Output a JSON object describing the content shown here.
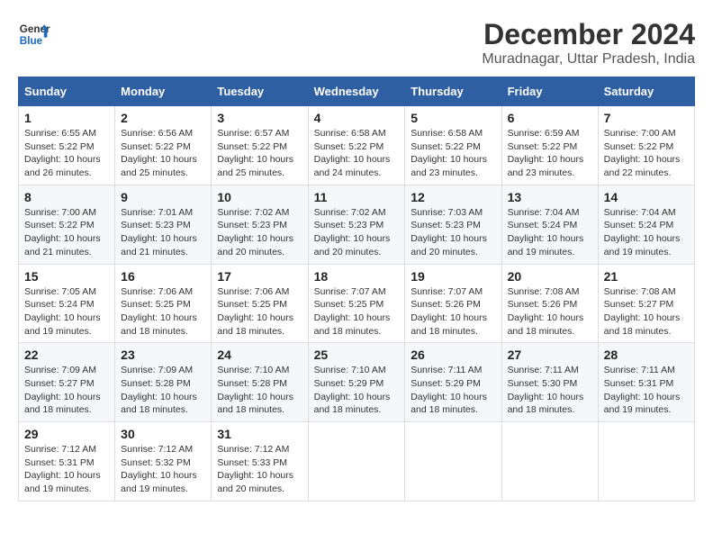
{
  "logo": {
    "line1": "General",
    "line2": "Blue"
  },
  "title": "December 2024",
  "subtitle": "Muradnagar, Uttar Pradesh, India",
  "header_days": [
    "Sunday",
    "Monday",
    "Tuesday",
    "Wednesday",
    "Thursday",
    "Friday",
    "Saturday"
  ],
  "weeks": [
    [
      {
        "day": "1",
        "sunrise": "6:55 AM",
        "sunset": "5:22 PM",
        "daylight": "10 hours and 26 minutes."
      },
      {
        "day": "2",
        "sunrise": "6:56 AM",
        "sunset": "5:22 PM",
        "daylight": "10 hours and 25 minutes."
      },
      {
        "day": "3",
        "sunrise": "6:57 AM",
        "sunset": "5:22 PM",
        "daylight": "10 hours and 25 minutes."
      },
      {
        "day": "4",
        "sunrise": "6:58 AM",
        "sunset": "5:22 PM",
        "daylight": "10 hours and 24 minutes."
      },
      {
        "day": "5",
        "sunrise": "6:58 AM",
        "sunset": "5:22 PM",
        "daylight": "10 hours and 23 minutes."
      },
      {
        "day": "6",
        "sunrise": "6:59 AM",
        "sunset": "5:22 PM",
        "daylight": "10 hours and 23 minutes."
      },
      {
        "day": "7",
        "sunrise": "7:00 AM",
        "sunset": "5:22 PM",
        "daylight": "10 hours and 22 minutes."
      }
    ],
    [
      {
        "day": "8",
        "sunrise": "7:00 AM",
        "sunset": "5:22 PM",
        "daylight": "10 hours and 21 minutes."
      },
      {
        "day": "9",
        "sunrise": "7:01 AM",
        "sunset": "5:23 PM",
        "daylight": "10 hours and 21 minutes."
      },
      {
        "day": "10",
        "sunrise": "7:02 AM",
        "sunset": "5:23 PM",
        "daylight": "10 hours and 20 minutes."
      },
      {
        "day": "11",
        "sunrise": "7:02 AM",
        "sunset": "5:23 PM",
        "daylight": "10 hours and 20 minutes."
      },
      {
        "day": "12",
        "sunrise": "7:03 AM",
        "sunset": "5:23 PM",
        "daylight": "10 hours and 20 minutes."
      },
      {
        "day": "13",
        "sunrise": "7:04 AM",
        "sunset": "5:24 PM",
        "daylight": "10 hours and 19 minutes."
      },
      {
        "day": "14",
        "sunrise": "7:04 AM",
        "sunset": "5:24 PM",
        "daylight": "10 hours and 19 minutes."
      }
    ],
    [
      {
        "day": "15",
        "sunrise": "7:05 AM",
        "sunset": "5:24 PM",
        "daylight": "10 hours and 19 minutes."
      },
      {
        "day": "16",
        "sunrise": "7:06 AM",
        "sunset": "5:25 PM",
        "daylight": "10 hours and 18 minutes."
      },
      {
        "day": "17",
        "sunrise": "7:06 AM",
        "sunset": "5:25 PM",
        "daylight": "10 hours and 18 minutes."
      },
      {
        "day": "18",
        "sunrise": "7:07 AM",
        "sunset": "5:25 PM",
        "daylight": "10 hours and 18 minutes."
      },
      {
        "day": "19",
        "sunrise": "7:07 AM",
        "sunset": "5:26 PM",
        "daylight": "10 hours and 18 minutes."
      },
      {
        "day": "20",
        "sunrise": "7:08 AM",
        "sunset": "5:26 PM",
        "daylight": "10 hours and 18 minutes."
      },
      {
        "day": "21",
        "sunrise": "7:08 AM",
        "sunset": "5:27 PM",
        "daylight": "10 hours and 18 minutes."
      }
    ],
    [
      {
        "day": "22",
        "sunrise": "7:09 AM",
        "sunset": "5:27 PM",
        "daylight": "10 hours and 18 minutes."
      },
      {
        "day": "23",
        "sunrise": "7:09 AM",
        "sunset": "5:28 PM",
        "daylight": "10 hours and 18 minutes."
      },
      {
        "day": "24",
        "sunrise": "7:10 AM",
        "sunset": "5:28 PM",
        "daylight": "10 hours and 18 minutes."
      },
      {
        "day": "25",
        "sunrise": "7:10 AM",
        "sunset": "5:29 PM",
        "daylight": "10 hours and 18 minutes."
      },
      {
        "day": "26",
        "sunrise": "7:11 AM",
        "sunset": "5:29 PM",
        "daylight": "10 hours and 18 minutes."
      },
      {
        "day": "27",
        "sunrise": "7:11 AM",
        "sunset": "5:30 PM",
        "daylight": "10 hours and 18 minutes."
      },
      {
        "day": "28",
        "sunrise": "7:11 AM",
        "sunset": "5:31 PM",
        "daylight": "10 hours and 19 minutes."
      }
    ],
    [
      {
        "day": "29",
        "sunrise": "7:12 AM",
        "sunset": "5:31 PM",
        "daylight": "10 hours and 19 minutes."
      },
      {
        "day": "30",
        "sunrise": "7:12 AM",
        "sunset": "5:32 PM",
        "daylight": "10 hours and 19 minutes."
      },
      {
        "day": "31",
        "sunrise": "7:12 AM",
        "sunset": "5:33 PM",
        "daylight": "10 hours and 20 minutes."
      },
      null,
      null,
      null,
      null
    ]
  ]
}
